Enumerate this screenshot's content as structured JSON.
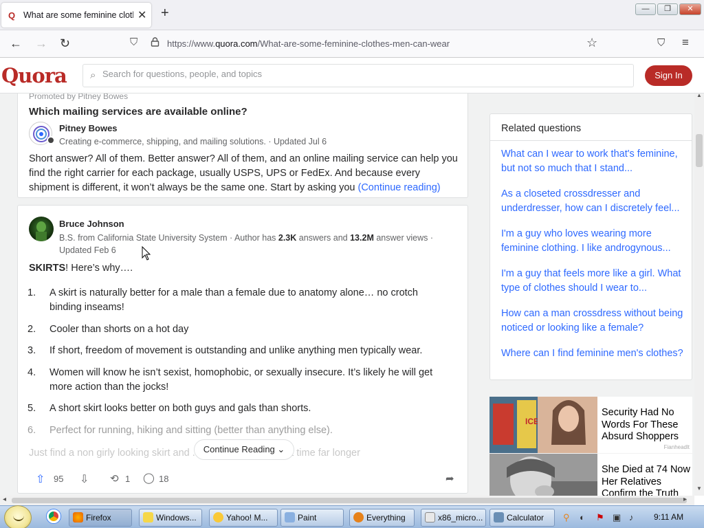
{
  "browser": {
    "tab_title": "What are some feminine clothes",
    "new_tab": "+",
    "url_prefix": "https://www.",
    "url_domain": "quora.com",
    "url_path": "/What-are-some-feminine-clothes-men-can-wear"
  },
  "quora": {
    "logo": "Quora",
    "search_placeholder": "Search for questions, people, and topics",
    "signin": "Sign In"
  },
  "promo_card": {
    "promoted_by": "Promoted by Pitney Bowes",
    "question": "Which mailing services are available online?",
    "author": "Pitney Bowes",
    "credential": "Creating e-commerce, shipping, and mailing solutions. · Updated Jul 6",
    "body": "Short answer? All of them. Better answer? All of them, and an online mailing service can help you find the right carrier for each package, usually USPS, UPS or FedEx. And because every shipment is different, it won’t always be the same one.  Start by asking you",
    "continue": "(Continue reading)"
  },
  "answer_card": {
    "author": "Bruce Johnson",
    "cred_start": "B.S. from California State University System · Author has ",
    "answers_count": "2.3K",
    "cred_mid": " answers and ",
    "views_count": "13.2M",
    "cred_end": " answer views · Updated Feb 6",
    "intro_bold": "SKIRTS",
    "intro_rest": "! Here’s why….",
    "points": [
      {
        "n": "1.",
        "text": "A skirt is naturally better for a male than a female due to anatomy alone… no crotch binding inseams!"
      },
      {
        "n": "2.",
        "text": "Cooler than shorts on a hot day"
      },
      {
        "n": "3.",
        "text": "If short, freedom of movement is outstanding and unlike anything men typically wear."
      },
      {
        "n": "4.",
        "text": "Women will know he isn’t sexist, homophobic, or sexually insecure. It’s likely he will get more action than the jocks!"
      },
      {
        "n": "5.",
        "text": "A short skirt looks better on both guys and gals than shorts."
      },
      {
        "n": "6.",
        "text": "Perfect for running, hiking and sitting (better than anything else)."
      }
    ],
    "tail": "Just find a non girly looking skirt and ...                        om skirts throughout time far longer",
    "continue_btn": "Continue Reading ⌄",
    "upvotes": "95",
    "shares": "1",
    "comments": "18"
  },
  "related": {
    "header": "Related questions",
    "questions": [
      "What can I wear to work that's feminine, but not so much that I stand...",
      "As a closeted crossdresser and underdresser, how can I discretely feel...",
      "I'm a guy who loves wearing more feminine clothing. I like androgynous...",
      "I'm a guy that feels more like a girl. What type of clothes should I wear to...",
      "How can a man crossdress without being noticed or looking like a female?",
      "Where can I find feminine men's clothes?"
    ]
  },
  "ads": [
    {
      "title": "Security Had No Words For These Absurd Shoppers",
      "source": "Fianheadlt"
    },
    {
      "title": "She Died at 74 Now Her Relatives Confirm the Truth"
    }
  ],
  "taskbar": {
    "items": [
      "Firefox",
      "Windows...",
      "Yahoo! M...",
      "Paint",
      "Everything",
      "x86_micro...",
      "Calculator"
    ],
    "clock": "9:11 AM"
  },
  "colors": {
    "brand": "#b92b27",
    "link": "#2e69ff"
  }
}
